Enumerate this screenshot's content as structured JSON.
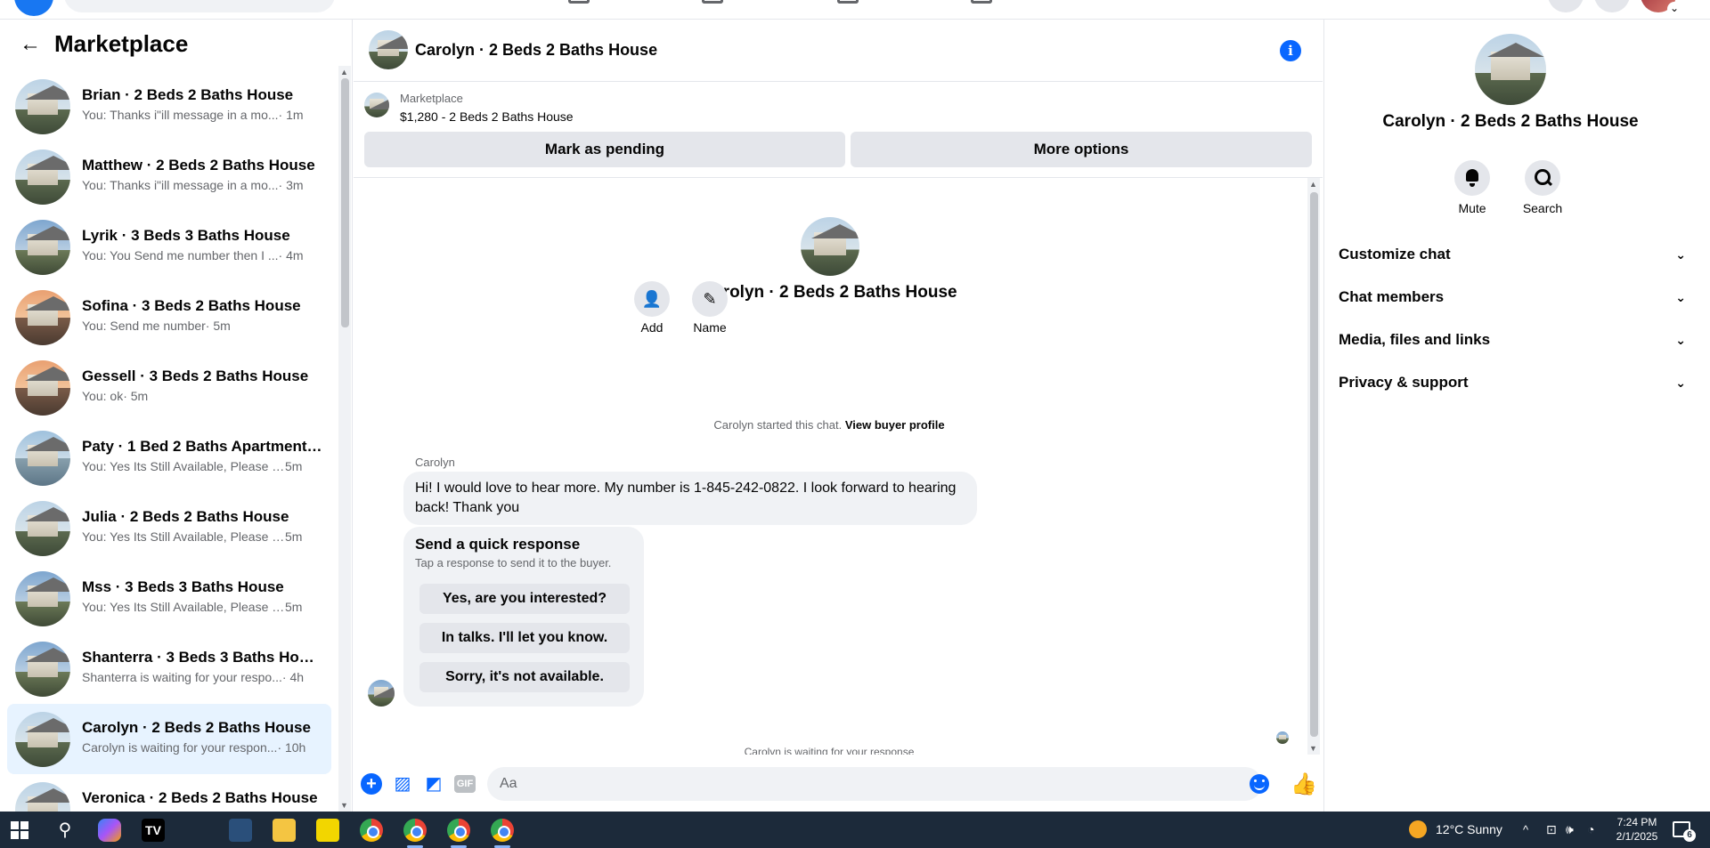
{
  "left_panel": {
    "title": "Marketplace",
    "conversations": [
      {
        "name": "Brian · 2 Beds 2 Baths House",
        "preview": "You: Thanks i\"ill message in a mo...",
        "time": "· 1m",
        "avatar": "house-icon"
      },
      {
        "name": "Matthew · 2 Beds 2 Baths House",
        "preview": "You: Thanks i\"ill message in a mo...",
        "time": "· 3m",
        "avatar": "house-icon"
      },
      {
        "name": "Lyrik · 3 Beds 3 Baths House",
        "preview": "You: You Send me number then I ...",
        "time": "· 4m",
        "avatar": "house-icon"
      },
      {
        "name": "Sofina · 3 Beds 2 Baths House",
        "preview": "You: Send me number",
        "time": "· 5m",
        "avatar": "house-icon"
      },
      {
        "name": "Gessell · 3 Beds 2 Baths House",
        "preview": "You: ok",
        "time": "· 5m",
        "avatar": "house-icon"
      },
      {
        "name": "Paty · 1 Bed 2 Baths Apartment/...",
        "preview": "You: Yes Its Still Available, Please S...",
        "time": "5m",
        "avatar": "apartment-icon"
      },
      {
        "name": "Julia · 2 Beds 2 Baths House",
        "preview": "You: Yes Its Still Available, Please S...",
        "time": "5m",
        "avatar": "house-icon"
      },
      {
        "name": "Mss · 3 Beds 3 Baths House",
        "preview": "You: Yes Its Still Available, Please S...",
        "time": "5m",
        "avatar": "house-icon"
      },
      {
        "name": "Shanterra · 3 Beds 3 Baths House",
        "preview": "Shanterra is waiting for your respo...",
        "time": "· 4h",
        "avatar": "house-icon"
      },
      {
        "name": "Carolyn · 2 Beds 2 Baths House",
        "preview": "Carolyn is waiting for your respon...",
        "time": "· 10h",
        "avatar": "house-icon",
        "active": true
      },
      {
        "name": "Veronica · 2 Beds 2 Baths House",
        "preview": "",
        "time": "",
        "avatar": "house-icon"
      }
    ]
  },
  "chat": {
    "header_title": "Carolyn · 2 Beds 2 Baths House",
    "listing": {
      "label": "Marketplace",
      "price_title": "$1,280 - 2 Beds 2 Baths House",
      "mark_pending": "Mark as pending",
      "more_options": "More options"
    },
    "intro": {
      "title": "Carolyn · 2 Beds 2 Baths House",
      "add_label": "Add",
      "name_label": "Name"
    },
    "started_text": "Carolyn started this chat.",
    "view_profile": "View buyer profile",
    "sender": "Carolyn",
    "message": "Hi! I would love to hear more. My number is 1-845-242-0822. I look forward to hearing back! Thank you",
    "quick_response": {
      "title": "Send a quick response",
      "subtitle": "Tap a response to send it to the buyer.",
      "options": [
        "Yes, are you interested?",
        "In talks. I'll let you know.",
        "Sorry, it's not available."
      ]
    },
    "typing_text": "Carolyn is waiting for your response",
    "composer": {
      "placeholder": "Aa",
      "gif_label": "GIF"
    }
  },
  "right_panel": {
    "title": "Carolyn · 2 Beds 2 Baths House",
    "mute_label": "Mute",
    "search_label": "Search",
    "sections": [
      "Customize chat",
      "Chat members",
      "Media, files and links",
      "Privacy & support"
    ]
  },
  "taskbar": {
    "weather": "12°C  Sunny",
    "time": "7:24 PM",
    "date": "2/1/2025",
    "notifications": "6"
  },
  "colors": {
    "accent": "#0866ff",
    "active_row": "#e7f3ff",
    "taskbar": "#1c2a3a"
  }
}
